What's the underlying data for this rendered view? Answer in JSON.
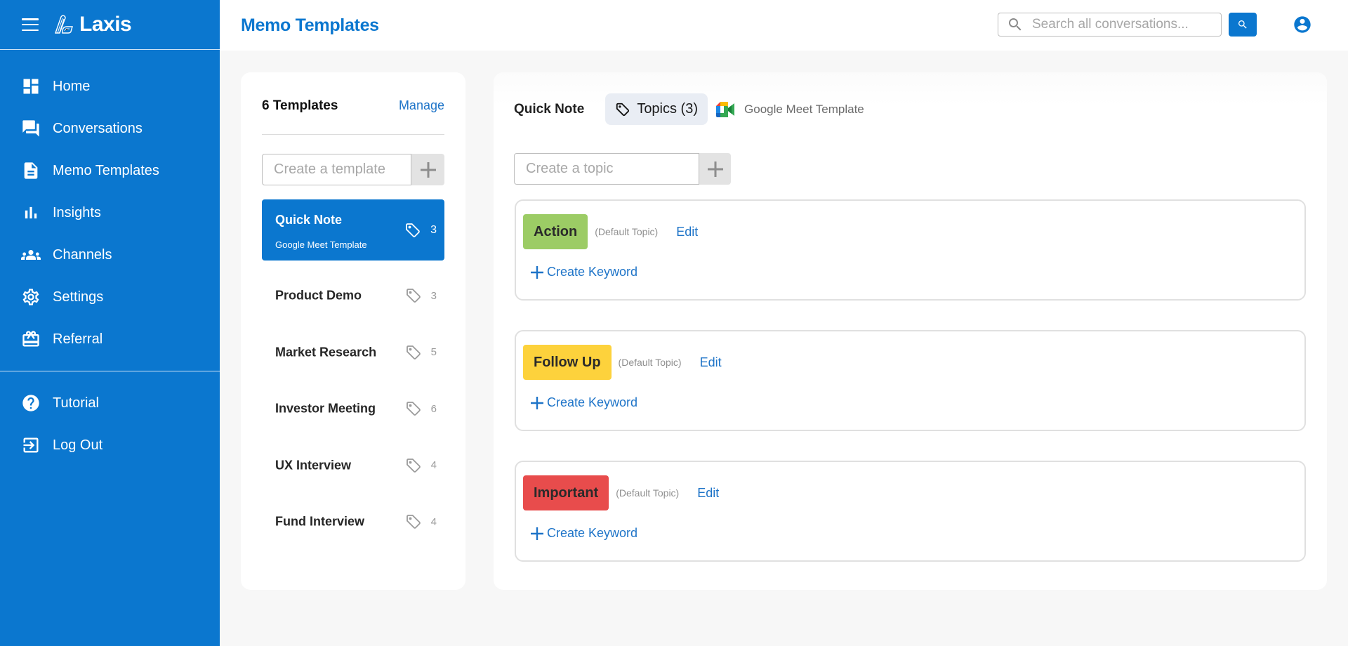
{
  "app": {
    "name": "Laxis",
    "brand_color": "#0b77cf"
  },
  "sidebar": {
    "menu_icon": "hamburger-icon",
    "logo_icon": "laxis-logo-icon",
    "items": [
      {
        "label": "Home",
        "icon": "dashboard-icon"
      },
      {
        "label": "Conversations",
        "icon": "chat-icon"
      },
      {
        "label": "Memo Templates",
        "icon": "document-icon"
      },
      {
        "label": "Insights",
        "icon": "bar-chart-icon"
      },
      {
        "label": "Channels",
        "icon": "people-icon"
      },
      {
        "label": "Settings",
        "icon": "gear-icon"
      },
      {
        "label": "Referral",
        "icon": "gift-card-icon"
      }
    ],
    "bottom_items": [
      {
        "label": "Tutorial",
        "icon": "help-icon"
      },
      {
        "label": "Log Out",
        "icon": "logout-icon"
      }
    ]
  },
  "header": {
    "title": "Memo Templates",
    "search_placeholder": "Search all conversations...",
    "search_value": ""
  },
  "templates_panel": {
    "title": "6 Templates",
    "manage_label": "Manage",
    "create_placeholder": "Create a template",
    "create_value": "",
    "items": [
      {
        "name": "Quick Note",
        "subtitle": "Google Meet Template",
        "count": "3",
        "selected": true
      },
      {
        "name": "Product Demo",
        "count": "3"
      },
      {
        "name": "Market Research",
        "count": "5"
      },
      {
        "name": "Investor Meeting",
        "count": "6"
      },
      {
        "name": "UX Interview",
        "count": "4"
      },
      {
        "name": "Fund Interview",
        "count": "4"
      }
    ]
  },
  "detail": {
    "title": "Quick Note",
    "topics_chip": "Topics (3)",
    "integration_label": "Google Meet Template",
    "topic_placeholder": "Create a topic",
    "topic_value": "",
    "topics": [
      {
        "name": "Action",
        "color": "#9ccc65",
        "default_label": "(Default Topic)",
        "edit_label": "Edit",
        "keyword_label": "Create Keyword"
      },
      {
        "name": "Follow Up",
        "color": "#fdd23c",
        "default_label": "(Default Topic)",
        "edit_label": "Edit",
        "keyword_label": "Create Keyword"
      },
      {
        "name": "Important",
        "color": "#e84c4c",
        "default_label": "(Default Topic)",
        "edit_label": "Edit",
        "keyword_label": "Create Keyword"
      }
    ]
  }
}
